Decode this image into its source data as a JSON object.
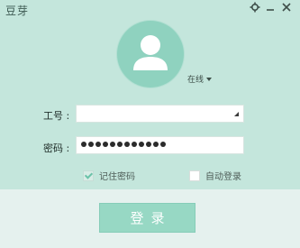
{
  "app": {
    "title": "豆芽"
  },
  "window_controls": {
    "settings_icon": "gear-icon",
    "minimize_icon": "minimize-icon",
    "close_icon": "close-icon"
  },
  "avatar": {
    "icon": "user-silhouette-icon",
    "circle_color": "#8fd2bf"
  },
  "status": {
    "label": "在线"
  },
  "form": {
    "employee_id_label": "工号 :",
    "employee_id_value": "",
    "password_label": "密码 :",
    "password_mask_count": 12
  },
  "options": {
    "remember_password": {
      "label": "记住密码",
      "checked": true
    },
    "auto_login": {
      "label": "自动登录",
      "checked": false
    }
  },
  "login_button": {
    "label": "登录"
  },
  "colors": {
    "accent": "#c4e6dc",
    "button": "#97d8c4",
    "footer": "#e5f1ee"
  }
}
